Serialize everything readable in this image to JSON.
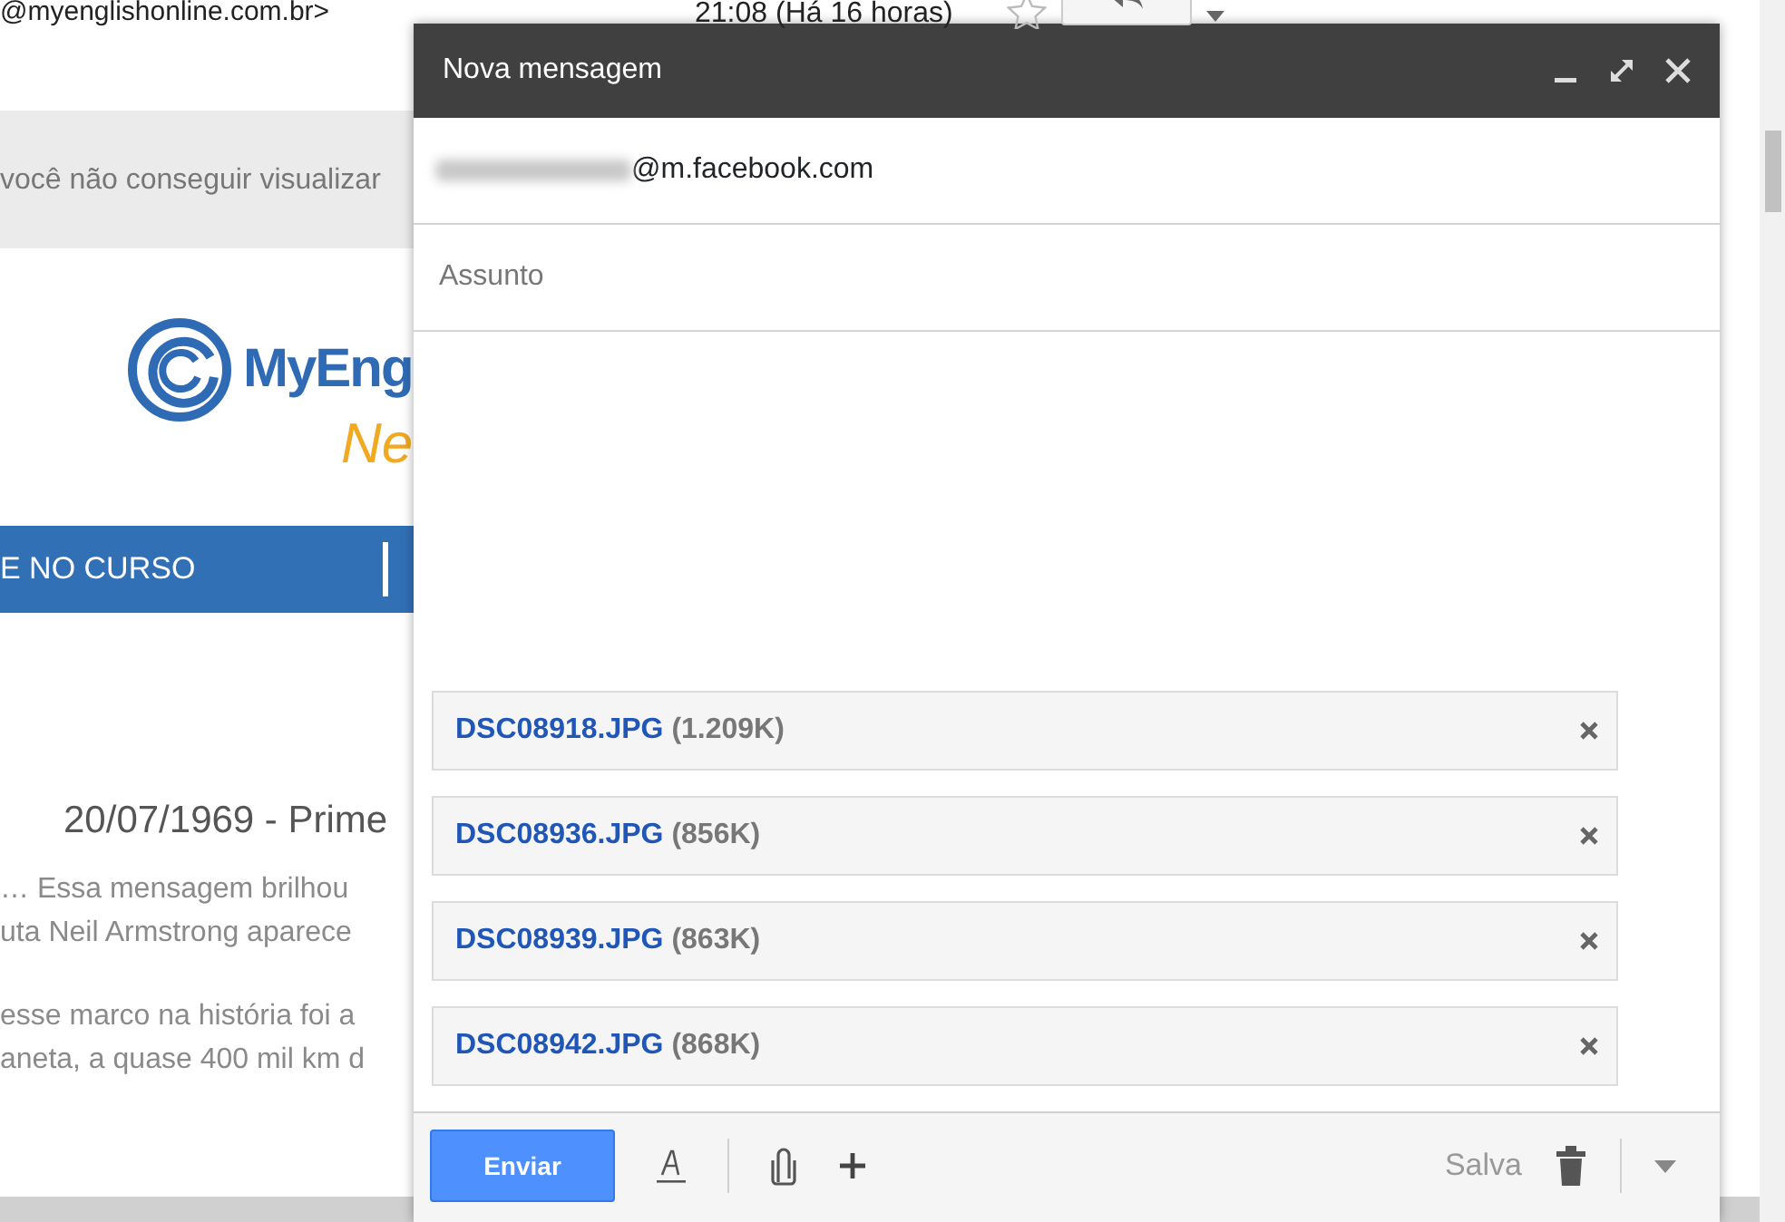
{
  "email": {
    "sender": "@myenglishonline.com.br>",
    "time": "21:08 (Há 16 horas)",
    "starred": false,
    "notice": "você não conseguir visualizar",
    "logo": {
      "word_1": "MyEng",
      "word_2": "Ne"
    },
    "nav_item": "E NO CURSO",
    "heading": "20/07/1969 - Prime",
    "paragraphs": [
      [
        "… Essa mensagem brilhou",
        "uta Neil Armstrong aparece"
      ],
      [
        "esse marco na história foi a",
        "aneta, a quase 400 mil km d"
      ]
    ]
  },
  "compose": {
    "title": "Nova mensagem",
    "to": "@m.facebook.com",
    "subject_placeholder": "Assunto",
    "attachments": [
      {
        "name": "DSC08918.JPG",
        "size": "(1.209K)"
      },
      {
        "name": "DSC08936.JPG",
        "size": "(856K)"
      },
      {
        "name": "DSC08939.JPG",
        "size": "(863K)"
      },
      {
        "name": "DSC08942.JPG",
        "size": "(868K)"
      }
    ],
    "send": "Enviar",
    "save_status": "Salva"
  }
}
